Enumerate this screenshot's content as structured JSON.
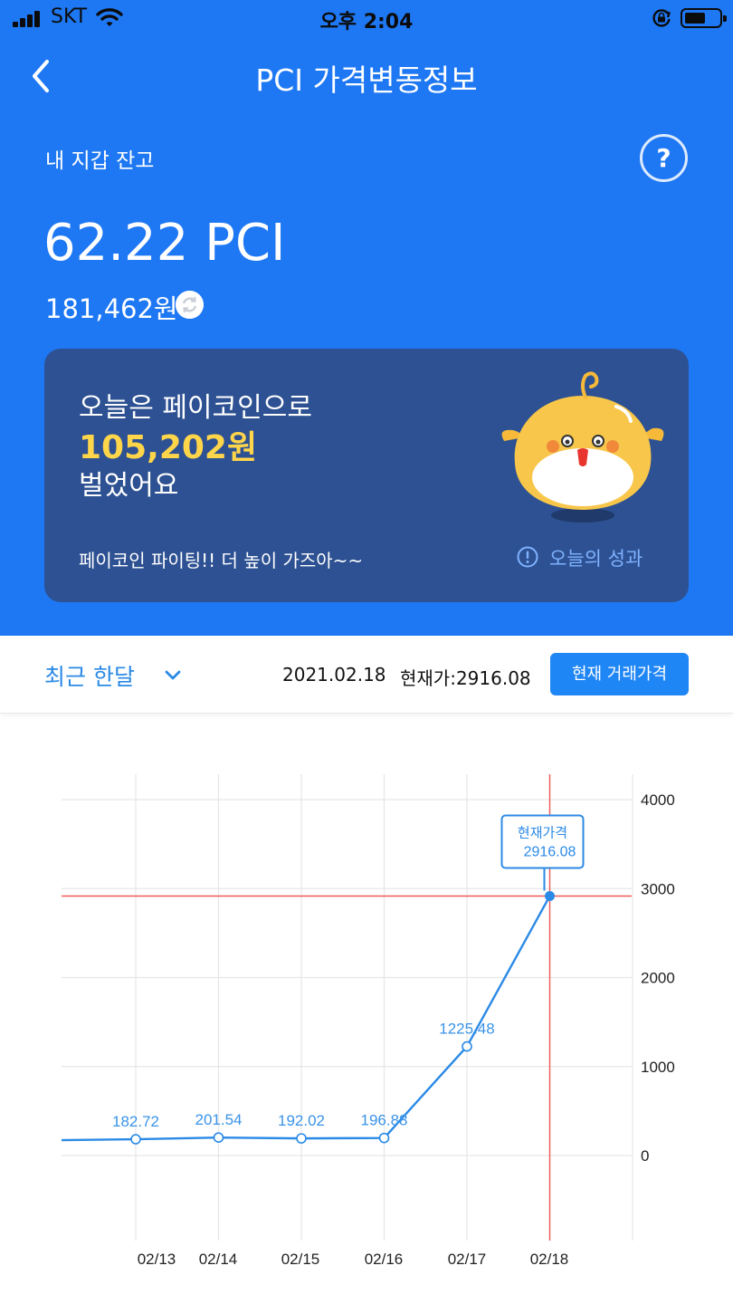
{
  "status_bar": {
    "carrier": "SKT",
    "time": "오후 2:04"
  },
  "header": {
    "title": "PCI 가격변동정보",
    "back_icon": "chevron-left-icon"
  },
  "wallet": {
    "label": "내 지갑 잔고",
    "help": "?",
    "balance": "62.22 PCI",
    "krw": "181,462원"
  },
  "card": {
    "line1": "오늘은 페이코인으로",
    "amount": "105,202원",
    "line3": "벌었어요",
    "cheer": "페이코인 파이팅!! 더 높이 가즈아~~",
    "perf_label": "오늘의 성과",
    "accent": "#ffd54a"
  },
  "filter": {
    "period": "최근 한달",
    "date": "2021.02.18",
    "current": "현재가:2916.08",
    "button": "현재 거래가격"
  },
  "colors": {
    "primary": "#1f78f3",
    "card": "#2d5192",
    "line": "#2b8ae6",
    "crosshair": "#f05a5a"
  },
  "chart_data": {
    "type": "line",
    "categories": [
      "02/13",
      "02/14",
      "02/15",
      "02/16",
      "02/17",
      "02/18"
    ],
    "series": [
      {
        "values": [
          182.72,
          201.54,
          192.02,
          196.88,
          1225.48,
          2916.08
        ]
      }
    ],
    "point_labels": [
      "182.72",
      "201.54",
      "192.02",
      "196.88",
      "1225.48"
    ],
    "y_ticks": [
      "0",
      "1000",
      "2000",
      "3000",
      "4000"
    ],
    "ylim": [
      0,
      4000
    ],
    "axis_position": "right",
    "grid": true,
    "tooltip": {
      "label": "현재가격",
      "value": "2916.08"
    }
  }
}
